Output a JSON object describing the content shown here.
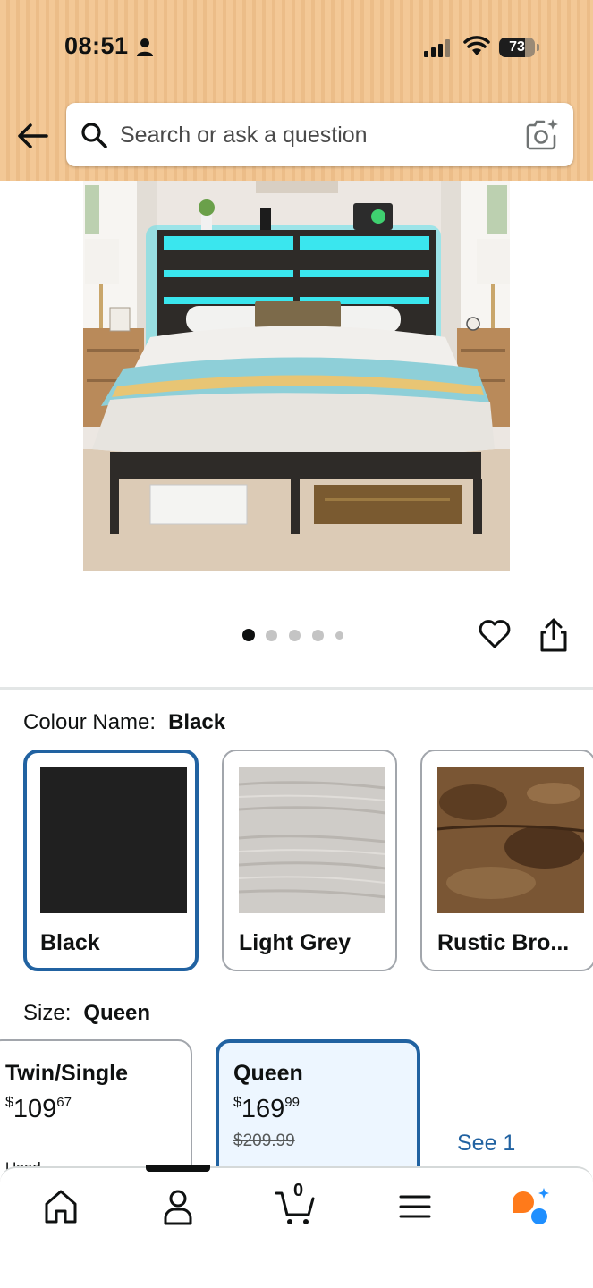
{
  "status_bar": {
    "time": "08:51",
    "battery": "73",
    "battery_level": 0.73,
    "icons": [
      "person-icon",
      "signal-icon",
      "wifi-icon",
      "battery-icon"
    ]
  },
  "search": {
    "placeholder": "Search or ask a question",
    "value": ""
  },
  "carousel": {
    "total": 5,
    "active_index": 0
  },
  "colour": {
    "label": "Colour Name:",
    "selected": "Black",
    "options": [
      {
        "label": "Black",
        "swatch": "#202020"
      },
      {
        "label": "Light Grey",
        "swatch": "#c9c6c2"
      },
      {
        "label": "Rustic Bro...",
        "swatch": "#6b4a2c"
      }
    ]
  },
  "size": {
    "label": "Size:",
    "selected": "Queen",
    "options": [
      {
        "name": "Twin/Single",
        "currency": "$",
        "whole": "109",
        "fraction": "67",
        "was": "",
        "condition": "Used"
      },
      {
        "name": "Queen",
        "currency": "$",
        "whole": "169",
        "fraction": "99",
        "was": "$209.99",
        "condition": ""
      }
    ],
    "see_more": "See 1"
  },
  "bottom_nav": {
    "cart_count": "0",
    "items": [
      "home-icon",
      "account-icon",
      "cart-icon",
      "menu-icon",
      "rufus-icon"
    ]
  },
  "colors": {
    "accent_blue": "#2162a1",
    "selected_bg": "#edf6ff",
    "header_bg": "#f3c896",
    "rufus_orange": "#ff7a1a",
    "rufus_blue": "#1f8fff"
  }
}
